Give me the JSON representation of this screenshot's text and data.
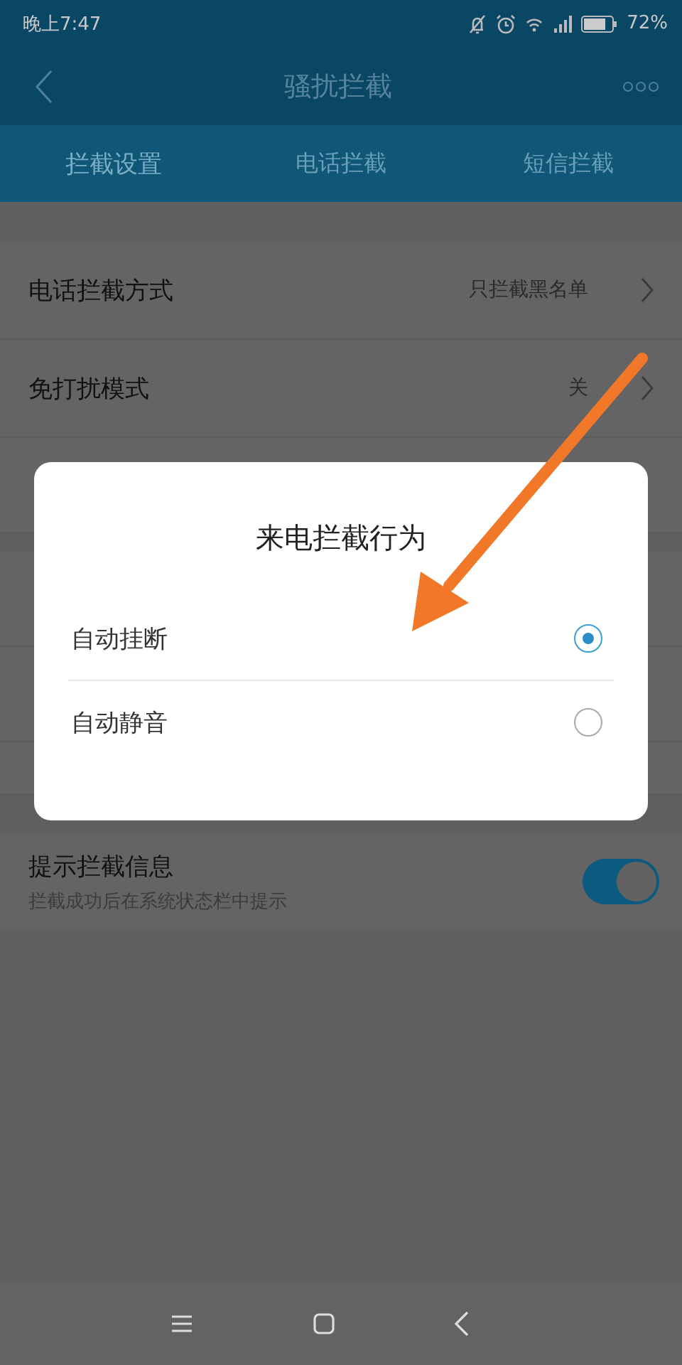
{
  "status_bar": {
    "time": "晚上7:47",
    "battery": "72%"
  },
  "header": {
    "title": "骚扰拦截"
  },
  "tabs": [
    {
      "label": "拦截设置",
      "selected": true
    },
    {
      "label": "电话拦截",
      "selected": false
    },
    {
      "label": "短信拦截",
      "selected": false
    }
  ],
  "settings": [
    {
      "label": "电话拦截方式",
      "value": "只拦截黑名单"
    },
    {
      "label": "免打扰模式",
      "value": "关"
    }
  ],
  "notify_row": {
    "label": "提示拦截信息",
    "description": "拦截成功后在系统状态栏中提示",
    "on": true
  },
  "dialog": {
    "title": "来电拦截行为",
    "options": [
      {
        "label": "自动挂断",
        "selected": true
      },
      {
        "label": "自动静音",
        "selected": false
      }
    ]
  }
}
